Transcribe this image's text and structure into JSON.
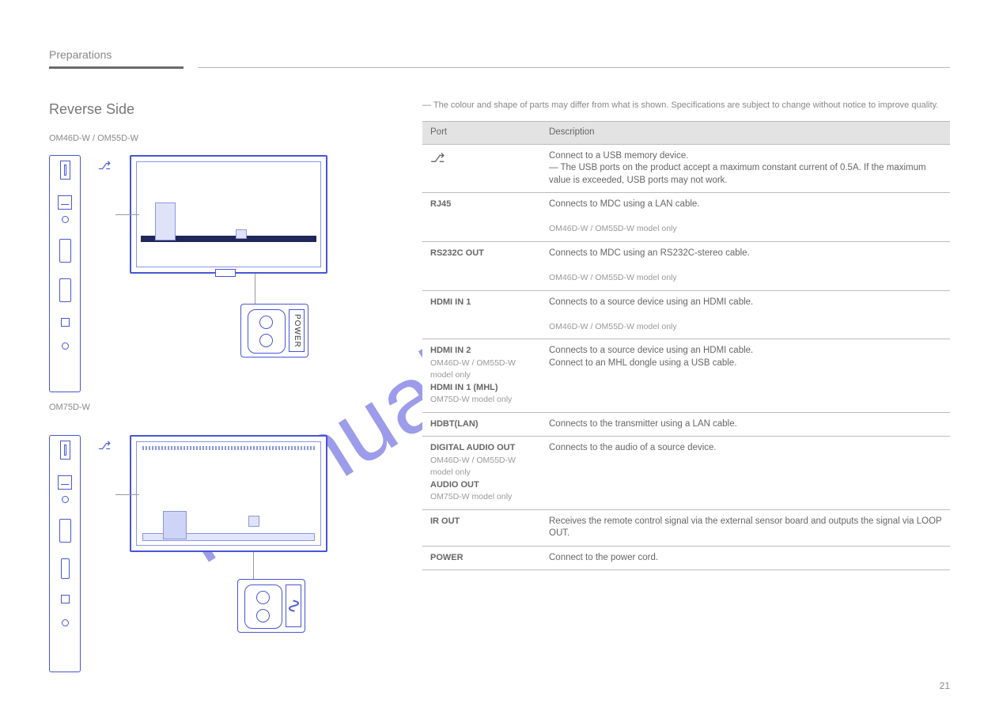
{
  "header": {
    "chapter_title": "Preparations"
  },
  "section": {
    "title": "Reverse Side",
    "model_a": "OM46D-W / OM55D-W",
    "model_b": "OM75D-W",
    "diagram_power_label": "POWER",
    "usb_icon": "⎓"
  },
  "caution": "The colour and shape of parts may differ from what is shown. Specifications are subject to change without notice to improve quality.",
  "table": {
    "head": {
      "port": "Port",
      "desc": "Description"
    },
    "rows": [
      {
        "port_html": "<span class='usb-glyph'>⎇</span>",
        "desc_lines": [
          "Connect to a USB memory device.",
          "― The USB ports on the product accept a maximum constant current of 0.5A. If the maximum value is exceeded, USB ports may not work."
        ]
      },
      {
        "port_html": "<span class='pname'>RJ45</span>",
        "desc_lines": [
          "Connects to MDC using a LAN cable.",
          "",
          "<span class='sub'>OM46D-W / OM55D-W model only</span>"
        ]
      },
      {
        "port_html": "<span class='pname'>RS232C OUT</span>",
        "desc_lines": [
          "Connects to MDC using an RS232C-stereo cable.",
          "",
          "<span class='sub'>OM46D-W / OM55D-W model only</span>"
        ]
      },
      {
        "port_html": "<span class='pname'>HDMI IN 1</span>",
        "desc_lines": [
          "Connects to a source device using an HDMI cable.",
          "",
          "<span class='sub'>OM46D-W / OM55D-W model only</span>"
        ]
      },
      {
        "port_html": "<span class='pname'>HDMI IN 2</span><br><span class='sub'>OM46D-W / OM55D-W model only</span><br><span class='pname'>HDMI IN 1 (MHL)</span><br><span class='sub'>OM75D-W model only</span>",
        "desc_lines": [
          "Connects to a source device using an HDMI cable.",
          "Connect to an MHL dongle using a USB cable."
        ]
      },
      {
        "port_html": "<span class='pname'>HDBT(LAN)</span>",
        "desc_lines": [
          "Connects to the transmitter using a LAN cable."
        ]
      },
      {
        "port_html": "<span class='pname'>DIGITAL AUDIO OUT</span><br><span class='sub'>OM46D-W / OM55D-W model only</span><br><span class='pname'>AUDIO OUT</span><br><span class='sub'>OM75D-W model only</span>",
        "desc_lines": [
          "Connects to the audio of a source device."
        ]
      },
      {
        "port_html": "<span class='pname'>IR OUT</span>",
        "desc_lines": [
          "Receives the remote control signal via the external sensor board and outputs the signal via LOOP OUT."
        ]
      },
      {
        "port_html": "<span class='pname'>POWER</span>",
        "desc_lines": [
          "Connect to the power cord."
        ]
      }
    ]
  },
  "page_number": "21"
}
